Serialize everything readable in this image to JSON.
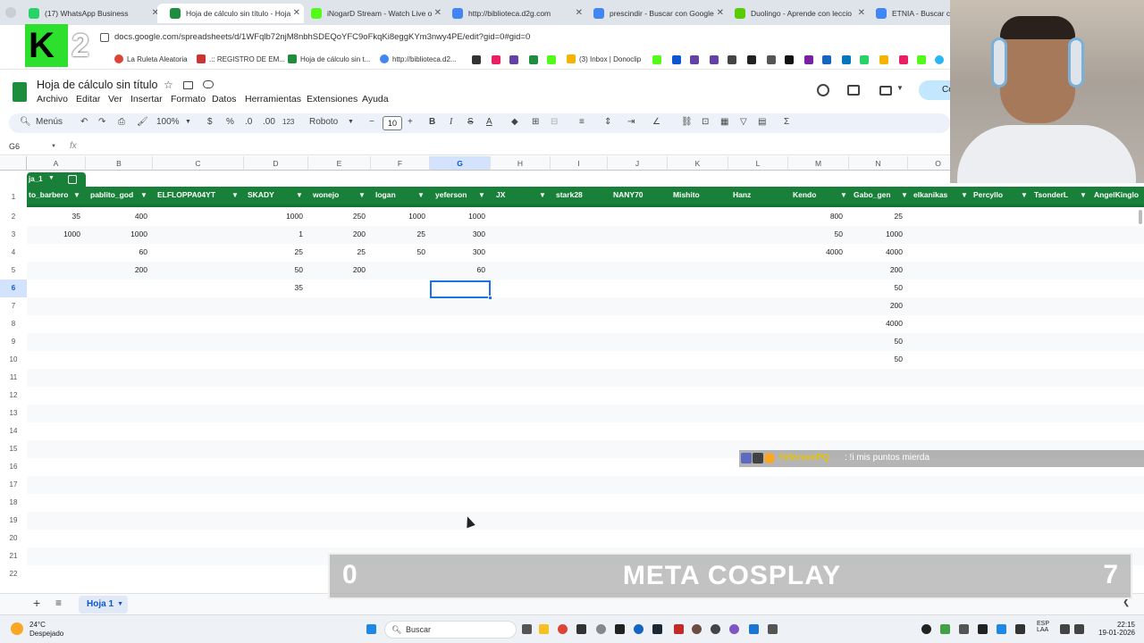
{
  "browser": {
    "tabs": [
      {
        "label": "(17) WhatsApp Business",
        "color": "#25d366",
        "active": false
      },
      {
        "label": "Hoja de cálculo sin título - Hoja",
        "color": "#1e8e3e",
        "active": true
      },
      {
        "label": "iNogarD Stream - Watch Live o",
        "color": "#53fc18",
        "active": false
      },
      {
        "label": "http://biblioteca.d2g.com",
        "color": "#4285f4",
        "active": false
      },
      {
        "label": "prescindir - Buscar con Google",
        "color": "#4285f4",
        "active": false
      },
      {
        "label": "Duolingo - Aprende con leccio",
        "color": "#58cc02",
        "active": false
      },
      {
        "label": "ETNIA - Buscar con",
        "color": "#4285f4",
        "active": false
      }
    ],
    "url": "docs.google.com/spreadsheets/d/1WFqlb72njM8nbhSDEQoYFC9oFkqKi8eggKYm3nwy4PE/edit?gid=0#gid=0",
    "bookmarks": [
      {
        "label": "La Ruleta Aleatoria"
      },
      {
        "label": ".:: REGISTRO DE EM..."
      },
      {
        "label": "Hoja de cálculo sin t..."
      },
      {
        "label": "http://biblioteca.d2..."
      },
      {
        "label": "(3) Inbox | Donoclip"
      }
    ]
  },
  "overlay": {
    "logo_letter": "K",
    "logo_number": "2",
    "chat_user": "YefersonPQ",
    "chat_message": ": !i mis puntos mierda",
    "score_left": "0",
    "score_title": "META COSPLAY",
    "score_right": "7"
  },
  "doc": {
    "title": "Hoja de cálculo sin título",
    "menus": [
      "Archivo",
      "Editar",
      "Ver",
      "Insertar",
      "Formato",
      "Datos",
      "Herramientas",
      "Extensiones",
      "Ayuda"
    ],
    "share_label": "Co"
  },
  "toolbar": {
    "search": "Menús",
    "zoom": "100%",
    "currency": "$",
    "percent": "%",
    "dec_minus": ".0",
    "dec_plus": ".00",
    "number_format": "123",
    "font": "Roboto",
    "font_size": "10",
    "bold": "B",
    "italic": "I",
    "strike": "S",
    "text_color": "A",
    "sum": "Σ"
  },
  "formula": {
    "namebox": "G6",
    "fx": "fx"
  },
  "grid": {
    "columns": [
      "A",
      "B",
      "C",
      "D",
      "E",
      "F",
      "G",
      "H",
      "I",
      "J",
      "K",
      "L",
      "M",
      "N",
      "O"
    ],
    "selected_column": "G",
    "selected_row": "6",
    "rows": [
      "1",
      "2",
      "3",
      "4",
      "5",
      "6",
      "7",
      "8",
      "9",
      "10",
      "11",
      "12",
      "13",
      "14",
      "15",
      "16",
      "17",
      "18",
      "19",
      "20",
      "21",
      "22"
    ],
    "table_name": "ja_1",
    "headers": [
      "to_barbero",
      "pablito_god",
      "ELFLOPPA04YT",
      "SKADY",
      "wonejo",
      "logan",
      "yeferson",
      "JX",
      "stark28",
      "NANY70",
      "Mishito",
      "Hanz",
      "Kendo",
      "Gabo_gen",
      "elkanikas",
      "Percyllo",
      "TsonderL",
      "AngelKinglo"
    ],
    "values": {
      "to_barbero": [
        "35",
        "1000",
        "",
        "",
        ""
      ],
      "pablito_god": [
        "400",
        "1000",
        "60",
        "200",
        ""
      ],
      "SKADY": [
        "1000",
        "1",
        "25",
        "50",
        "35"
      ],
      "wonejo": [
        "250",
        "200",
        "25",
        "200",
        ""
      ],
      "logan": [
        "1000",
        "25",
        "50",
        "",
        ""
      ],
      "yeferson": [
        "1000",
        "300",
        "300",
        "60",
        ""
      ],
      "Kendo": [
        "800",
        "50",
        "4000",
        "",
        ""
      ],
      "Gabo_gen": [
        "25",
        "1000",
        "4000",
        "200",
        "50",
        "200",
        "4000",
        "50",
        "50"
      ]
    }
  },
  "sheets": {
    "add": "+",
    "menu": "≡",
    "active_tab": "Hoja 1"
  },
  "taskbar": {
    "temp": "24°C",
    "weather": "Despejado",
    "search": "Buscar",
    "lang": "ESP",
    "lang2": "LAA",
    "time": "22:15",
    "date": "19-01-2026"
  }
}
